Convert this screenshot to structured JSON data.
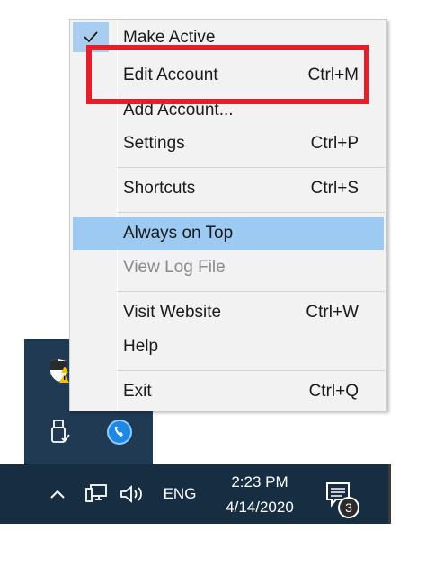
{
  "menu": {
    "items": [
      {
        "label": "Make Active",
        "shortcut": "",
        "checked": true
      },
      {
        "label": "Edit Account",
        "shortcut": "Ctrl+M"
      },
      {
        "label": "Add Account...",
        "shortcut": ""
      },
      {
        "label": "Settings",
        "shortcut": "Ctrl+P"
      },
      {
        "label": "Shortcuts",
        "shortcut": "Ctrl+S"
      },
      {
        "label": "Always on Top",
        "shortcut": "",
        "highlighted": true
      },
      {
        "label": "View Log File",
        "shortcut": "",
        "disabled": true
      },
      {
        "label": "Visit Website",
        "shortcut": "Ctrl+W"
      },
      {
        "label": "Help",
        "shortcut": ""
      },
      {
        "label": "Exit",
        "shortcut": "Ctrl+Q"
      }
    ],
    "check_icon": "checkmark-icon"
  },
  "annotation": {
    "color": "#e0202a",
    "target": "Edit Account"
  },
  "tray_flyout": {
    "icons": [
      "security-shield-warning-icon",
      "usb-drive-icon",
      "phone-app-icon"
    ]
  },
  "taskbar": {
    "chevron_icon": "chevron-up-icon",
    "network_icon": "network-icon",
    "volume_icon": "speaker-icon",
    "language": "ENG",
    "time": "2:23 PM",
    "date": "4/14/2020",
    "notifications_icon": "action-center-icon",
    "notification_count": "3"
  },
  "colors": {
    "taskbar": "#172e42",
    "flyout": "#1f3a52",
    "menu_bg": "#f2f2f2",
    "highlight": "#9ccaf2"
  }
}
